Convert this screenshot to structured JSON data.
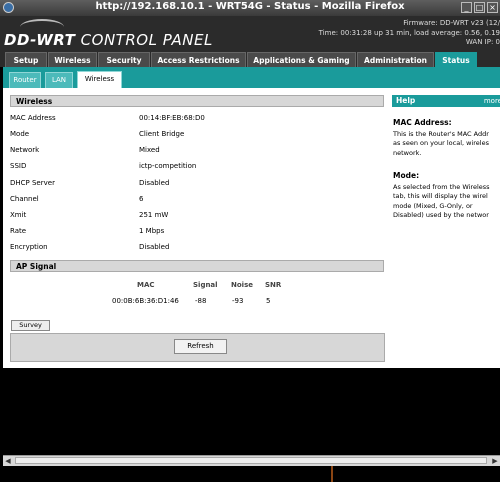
{
  "window": {
    "title": "http://192.168.10.1 - WRT54G - Status - Mozilla Firefox"
  },
  "header": {
    "logo_text": "DD-WRT",
    "logo_sub": "CONTROL PANEL",
    "firmware": "Firmware: DD-WRT v23 (12/",
    "time": "Time: 00:31:28 up 31 min, load average: 0.56, 0.19",
    "wan_ip": "WAN IP: 0"
  },
  "nav": {
    "tabs": [
      "Setup",
      "Wireless",
      "Security",
      "Access Restrictions",
      "Applications & Gaming",
      "Administration",
      "Status"
    ],
    "active": "Status"
  },
  "subnav": {
    "tabs": [
      "Router",
      "LAN",
      "Wireless"
    ],
    "active": "Wireless"
  },
  "wireless": {
    "heading": "Wireless",
    "rows": [
      {
        "label": "MAC Address",
        "value": "00:14:BF:EB:68:D0"
      },
      {
        "label": "Mode",
        "value": "Client Bridge"
      },
      {
        "label": "Network",
        "value": "Mixed"
      },
      {
        "label": "SSID",
        "value": "ictp-competition"
      },
      {
        "label": "DHCP Server",
        "value": "Disabled"
      },
      {
        "label": "Channel",
        "value": "6"
      },
      {
        "label": "Xmit",
        "value": "251 mW"
      },
      {
        "label": "Rate",
        "value": "1 Mbps"
      },
      {
        "label": "Encryption",
        "value": "Disabled"
      }
    ]
  },
  "ap_signal": {
    "heading": "AP Signal",
    "columns": [
      "MAC",
      "Signal",
      "Noise",
      "SNR"
    ],
    "rows": [
      {
        "mac": "00:0B:6B:36:D1:46",
        "signal": "-88",
        "noise": "-93",
        "snr": "5"
      }
    ]
  },
  "buttons": {
    "survey": "Survey",
    "refresh": "Refresh"
  },
  "help": {
    "heading": "Help",
    "more": "more",
    "mac_title": "MAC Address:",
    "mac_lines": [
      "This is the Router's MAC Addr",
      "as seen on your local, wireles",
      "network."
    ],
    "mode_title": "Mode:",
    "mode_lines": [
      "As selected from the Wireless",
      "tab, this will display the wirel",
      "mode (Mixed, G-Only, or",
      "Disabled) used by the networ"
    ]
  }
}
